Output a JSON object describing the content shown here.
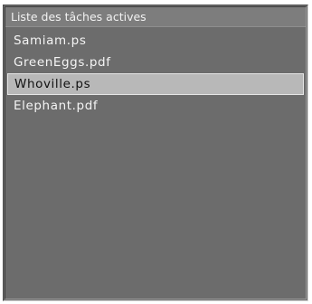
{
  "active_tasks": {
    "header": "Liste des tâches actives",
    "items": [
      {
        "label": "Samiam.ps",
        "selected": false
      },
      {
        "label": "GreenEggs.pdf",
        "selected": false
      },
      {
        "label": "Whoville.ps",
        "selected": true
      },
      {
        "label": "Elephant.pdf",
        "selected": false
      }
    ]
  }
}
